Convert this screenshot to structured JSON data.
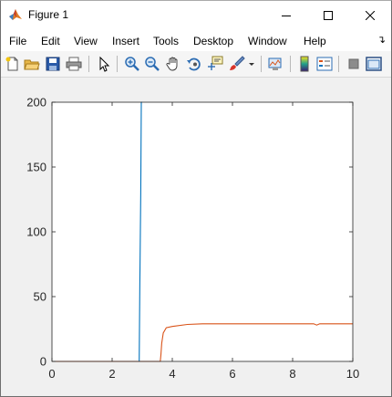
{
  "window": {
    "title": "Figure 1",
    "controls": [
      "minimize-icon",
      "maximize-icon",
      "close-icon"
    ]
  },
  "menu": {
    "items": [
      "File",
      "Edit",
      "View",
      "Insert",
      "Tools",
      "Desktop",
      "Window",
      "Help"
    ],
    "overflow_icon": "dock-arrow-icon"
  },
  "toolbar": {
    "icons": [
      "new-figure-icon",
      "open-file-icon",
      "save-icon",
      "print-icon",
      "edit-pointer-icon",
      "zoom-in-icon",
      "zoom-out-icon",
      "pan-hand-icon",
      "rotate-3d-icon",
      "data-cursor-icon",
      "brush-icon",
      "link-plot-icon",
      "insert-colorbar-icon",
      "insert-legend-icon",
      "hide-plot-tools-icon",
      "show-plot-tools-icon"
    ]
  },
  "colors": {
    "series1": "#0072bd",
    "series2": "#d95319",
    "figure_bg": "#f0f0f0"
  },
  "chart_data": {
    "type": "line",
    "xlim": [
      0,
      10
    ],
    "ylim": [
      0,
      200
    ],
    "xticks": [
      "0",
      "2",
      "4",
      "6",
      "8",
      "10"
    ],
    "yticks": [
      "0",
      "50",
      "100",
      "150",
      "200"
    ],
    "grid": false,
    "series": [
      {
        "color": "#0072bd",
        "x": [
          0,
          2.9,
          2.9,
          2.92,
          2.95,
          2.97,
          3.0
        ],
        "y": [
          0,
          0,
          0,
          60,
          130,
          200,
          200
        ]
      },
      {
        "color": "#d95319",
        "x": [
          0,
          3.6,
          3.62,
          3.65,
          3.7,
          3.8,
          4.0,
          4.5,
          5.0,
          6.0,
          7.0,
          8.0,
          8.7,
          8.8,
          8.9,
          9.5,
          10.0
        ],
        "y": [
          0,
          0,
          5,
          14,
          22,
          26,
          27,
          28.5,
          29,
          29,
          29,
          29,
          29,
          28,
          29,
          29,
          29
        ]
      }
    ]
  }
}
